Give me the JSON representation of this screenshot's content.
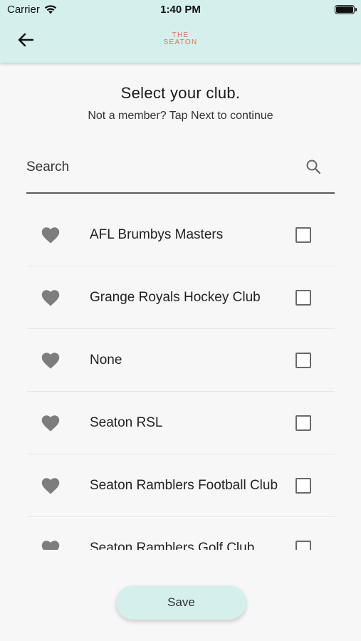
{
  "status_bar": {
    "carrier": "Carrier",
    "time": "1:40 PM"
  },
  "header": {
    "back_icon": "arrow-left-icon",
    "logo_line1": "THE",
    "logo_line2": "SEATON",
    "logo_color": "#d9765a",
    "bar_color": "#d5efec"
  },
  "page": {
    "title": "Select your club.",
    "subtitle": "Not a member? Tap Next to continue"
  },
  "search": {
    "placeholder": "Search",
    "icon": "search-icon"
  },
  "clubs": [
    {
      "name": "AFL Brumbys Masters",
      "favorite_icon": "heart-icon",
      "checked": false
    },
    {
      "name": "Grange Royals Hockey Club",
      "favorite_icon": "heart-icon",
      "checked": false
    },
    {
      "name": "None",
      "favorite_icon": "heart-icon",
      "checked": false
    },
    {
      "name": "Seaton RSL",
      "favorite_icon": "heart-icon",
      "checked": false
    },
    {
      "name": "Seaton Ramblers Football Club",
      "favorite_icon": "heart-icon",
      "checked": false
    },
    {
      "name": "Seaton Ramblers Golf Club",
      "favorite_icon": "heart-icon",
      "checked": false
    }
  ],
  "actions": {
    "save_label": "Save"
  }
}
